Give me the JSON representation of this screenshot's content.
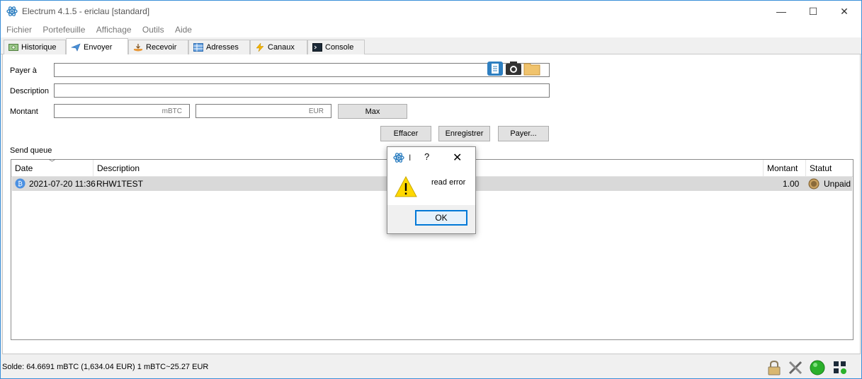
{
  "window": {
    "title": "Electrum 4.1.5  -  ericlau  [standard]",
    "minimize": "—",
    "maximize": "☐",
    "close": "✕"
  },
  "menu": [
    "Fichier",
    "Portefeuille",
    "Affichage",
    "Outils",
    "Aide"
  ],
  "tabs": [
    "Historique",
    "Envoyer",
    "Recevoir",
    "Adresses",
    "Canaux",
    "Console"
  ],
  "active_tab": "Envoyer",
  "form": {
    "payto_label": "Payer à",
    "payto_value": "",
    "description_label": "Description",
    "description_value": "",
    "amount_label": "Montant",
    "amount_btc_value": "",
    "amount_btc_unit": "mBTC",
    "amount_fiat_value": "",
    "amount_fiat_unit": "EUR",
    "max_button": "Max",
    "clear_button": "Effacer",
    "save_button": "Enregistrer",
    "pay_button": "Payer..."
  },
  "queue": {
    "label": "Send queue",
    "columns": [
      "Date",
      "Description",
      "Montant",
      "Statut"
    ],
    "rows": [
      {
        "date": "2021-07-20 11:36",
        "description": "RHW1TEST",
        "amount": "1.00",
        "status": "Unpaid"
      }
    ]
  },
  "status_bar": {
    "text": "Solde: 64.6691 mBTC (1,634.04 EUR)  1 mBTC~25.27 EUR"
  },
  "dialog": {
    "title": "I",
    "help": "?",
    "close": "✕",
    "message": "read error",
    "ok_button": "OK"
  },
  "colors": {
    "window_border": "#3a8fd9",
    "row_selected": "#d9d9d9",
    "network_ok": "#2bb02b",
    "ok_border": "#0078d7"
  }
}
